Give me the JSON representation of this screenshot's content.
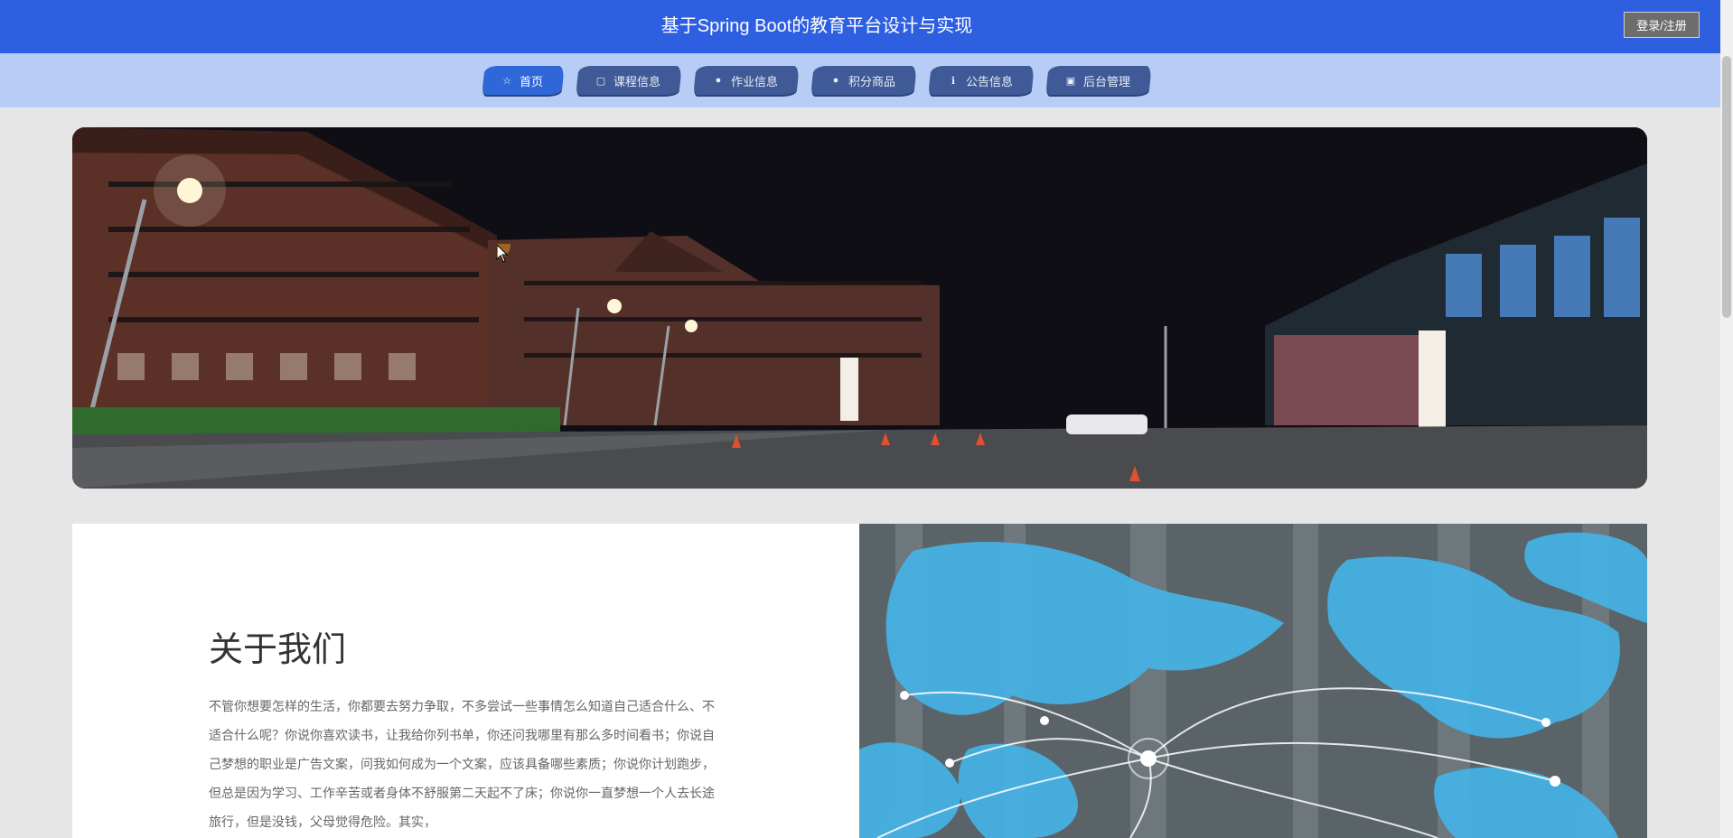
{
  "header": {
    "title": "基于Spring Boot的教育平台设计与实现",
    "login_label": "登录/注册",
    "bg_color": "#2e5fe0"
  },
  "nav": {
    "items": [
      {
        "label": "首页",
        "icon": "star-icon",
        "active": true
      },
      {
        "label": "课程信息",
        "icon": "book-icon",
        "active": false
      },
      {
        "label": "作业信息",
        "icon": "circle-icon",
        "active": false
      },
      {
        "label": "积分商品",
        "icon": "circle-icon",
        "active": false
      },
      {
        "label": "公告信息",
        "icon": "info-icon",
        "active": false
      },
      {
        "label": "后台管理",
        "icon": "building-icon",
        "active": false
      }
    ]
  },
  "about": {
    "title": "关于我们",
    "text": "不管你想要怎样的生活，你都要去努力争取，不多尝试一些事情怎么知道自己适合什么、不适合什么呢？你说你喜欢读书，让我给你列书单，你还问我哪里有那么多时间看书；你说自己梦想的职业是广告文案，问我如何成为一个文案，应该具备哪些素质；你说你计划跑步，但总是因为学习、工作辛苦或者身体不舒服第二天起不了床；你说你一直梦想一个人去长途旅行，但是没钱，父母觉得危险。其实，"
  }
}
